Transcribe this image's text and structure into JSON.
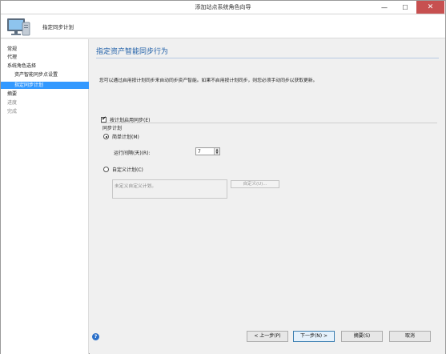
{
  "window": {
    "title": "添加站点系统角色向导",
    "controls": {
      "minimize": "—",
      "maximize": "☐",
      "close": "✕"
    }
  },
  "header": {
    "icon": "computer-monitor-icon",
    "title": "指定同步计划"
  },
  "nav": {
    "items": [
      {
        "label": "常规",
        "level": 0,
        "state": "normal"
      },
      {
        "label": "代理",
        "level": 0,
        "state": "normal"
      },
      {
        "label": "系统角色选择",
        "level": 0,
        "state": "normal"
      },
      {
        "label": "资产智能同步点设置",
        "level": 1,
        "state": "normal"
      },
      {
        "label": "指定同步计划",
        "level": 1,
        "state": "selected"
      },
      {
        "label": "摘要",
        "level": 0,
        "state": "normal"
      },
      {
        "label": "进度",
        "level": 0,
        "state": "disabled"
      },
      {
        "label": "完成",
        "level": 0,
        "state": "disabled"
      }
    ],
    "selected_color": "#3399ff"
  },
  "content": {
    "title": "指定资产智能同步行为",
    "intro": "您可以通过启用按计划同步来自动同步资产智能。如果不启用按计划同步，则您必须手动同步以获取更新。",
    "enable_schedule": {
      "label": "按计划启用同步(E)",
      "checked": true
    },
    "schedule_group_label": "同步计划",
    "simple_schedule": {
      "label": "简单计划(M)",
      "selected": true
    },
    "interval": {
      "label": "运行间隔(天)(R):",
      "value": "7"
    },
    "custom_schedule": {
      "label": "自定义计划(C)",
      "selected": false
    },
    "custom_placeholder": "未定义自定义计划。",
    "custom_button": "自定义(U)..."
  },
  "footer": {
    "help_icon": "help-icon",
    "back": "< 上一步(P)",
    "next": "下一步(N) >",
    "summary": "摘要(S)",
    "cancel": "取消"
  },
  "colors": {
    "title_blue": "#1f5fa8",
    "close_red": "#c75050"
  }
}
